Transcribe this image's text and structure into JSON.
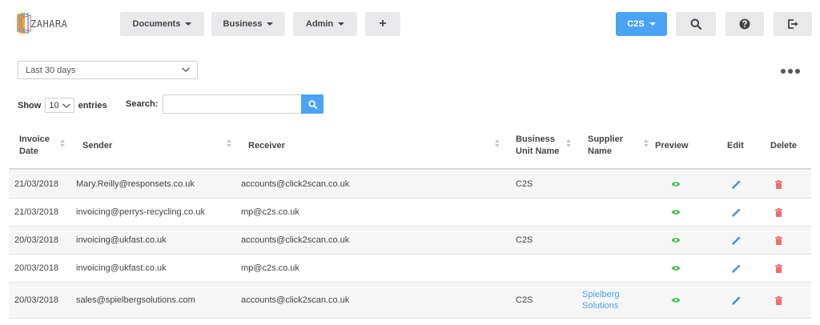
{
  "brand": {
    "name": "ZAHARA"
  },
  "nav": {
    "documents": "Documents",
    "business": "Business",
    "admin": "Admin",
    "add": "+",
    "company": "C2S"
  },
  "filter": {
    "range": "Last 30 days"
  },
  "controls": {
    "show": "Show",
    "entries_value": "10",
    "entries": "entries",
    "search_label": "Search:",
    "search_value": ""
  },
  "table": {
    "columns": {
      "invoice_date": "Invoice Date",
      "sender": "Sender",
      "receiver": "Receiver",
      "business_unit": "Business Unit Name",
      "supplier": "Supplier Name",
      "preview": "Preview",
      "edit": "Edit",
      "delete": "Delete"
    },
    "rows": [
      {
        "date": "21/03/2018",
        "sender": "Mary.Reilly@responsets.co.uk",
        "receiver": "accounts@click2scan.co.uk",
        "unit": "C2S",
        "supplier": ""
      },
      {
        "date": "21/03/2018",
        "sender": "invoicing@perrys-recycling.co.uk",
        "receiver": "mp@c2s.co.uk",
        "unit": "",
        "supplier": ""
      },
      {
        "date": "20/03/2018",
        "sender": "invoicing@ukfast.co.uk",
        "receiver": "accounts@click2scan.co.uk",
        "unit": "C2S",
        "supplier": ""
      },
      {
        "date": "20/03/2018",
        "sender": "invoicing@ukfast.co.uk",
        "receiver": "mp@c2s.co.uk",
        "unit": "",
        "supplier": ""
      },
      {
        "date": "20/03/2018",
        "sender": "sales@spielbergsolutions.com",
        "receiver": "accounts@click2scan.co.uk",
        "unit": "C2S",
        "supplier": "Spielberg Solutions"
      }
    ]
  },
  "colors": {
    "accent": "#4aa3f4",
    "preview": "#3cc13b",
    "edit": "#3b8fe6",
    "delete": "#f26d6d"
  }
}
